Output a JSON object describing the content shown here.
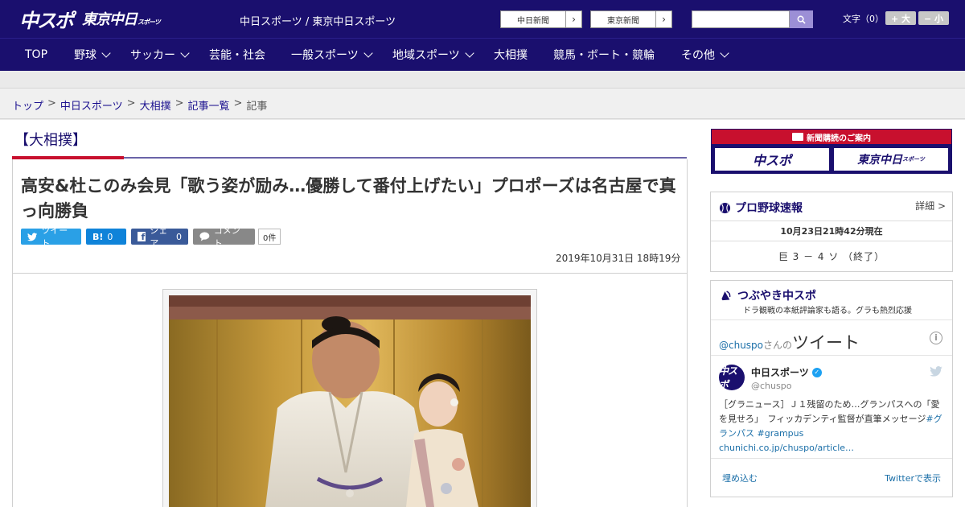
{
  "header": {
    "logo_main": "中スポ",
    "logo_sub": "東京中日",
    "logo_sub_small": "スポーツ",
    "site_name": "中日スポーツ / 東京中日スポーツ",
    "paper_links": [
      "中日新聞",
      "東京新聞"
    ],
    "font_size_label": "文字（0）",
    "font_plus": "+ 大",
    "font_minus": "− 小"
  },
  "nav": {
    "items": [
      {
        "label": "TOP",
        "dropdown": false
      },
      {
        "label": "野球",
        "dropdown": true
      },
      {
        "label": "サッカー",
        "dropdown": true
      },
      {
        "label": "芸能・社会",
        "dropdown": false
      },
      {
        "label": "一般スポーツ",
        "dropdown": true
      },
      {
        "label": "地域スポーツ",
        "dropdown": true
      },
      {
        "label": "大相撲",
        "dropdown": false
      },
      {
        "label": "競馬・ボート・競輪",
        "dropdown": false
      },
      {
        "label": "その他",
        "dropdown": true
      }
    ]
  },
  "breadcrumb": {
    "items": [
      "トップ",
      "中日スポーツ",
      "大相撲",
      "記事一覧"
    ],
    "separator": ">",
    "current": "記事"
  },
  "article": {
    "category": "【大相撲】",
    "headline": "高安&杜このみ会見「歌う姿が励み…優勝して番付上げたい」プロポーズは名古屋で真っ向勝負",
    "share": {
      "tweet": "ツイート",
      "hatena": "B!",
      "hatena_count": "0",
      "facebook": "シェア",
      "facebook_count": "0",
      "comment": "コメント",
      "comment_count": "0件"
    },
    "date": "2019年10月31日 18時19分"
  },
  "sidebar": {
    "subscribe": {
      "head": "新聞購読のご案内",
      "btn1": "中スポ",
      "btn2": "東京中日",
      "btn2_small": "スポーツ"
    },
    "baseball": {
      "title": "プロ野球速報",
      "detail": "詳細 >",
      "time": "10月23日21時42分現在",
      "score": "巨 3 － 4 ソ （終了）"
    },
    "tweets": {
      "title": "つぶやき中スポ",
      "subtitle": "ドラ観戦の本紙評論家も語る。グラも熱烈応援",
      "handle": "@chuspo",
      "handle_suffix": "さんの",
      "handle_title": "ツイート",
      "avatar": "中スポ",
      "name": "中日スポーツ",
      "user": "@chuspo",
      "text": "［グラニュース］Ｊ１残留のため…グランパスへの「愛を見せろ」　フィッカデンティ監督が直筆メッセージ",
      "hashtags": "#グランパス #grampus",
      "link": "chunichi.co.jp/chuspo/article…",
      "embed": "埋め込む",
      "view": "Twitterで表示"
    }
  },
  "colors": {
    "brand_navy": "#1a0f6e",
    "accent_red": "#c8102e",
    "link_blue": "#1b6fa8"
  }
}
